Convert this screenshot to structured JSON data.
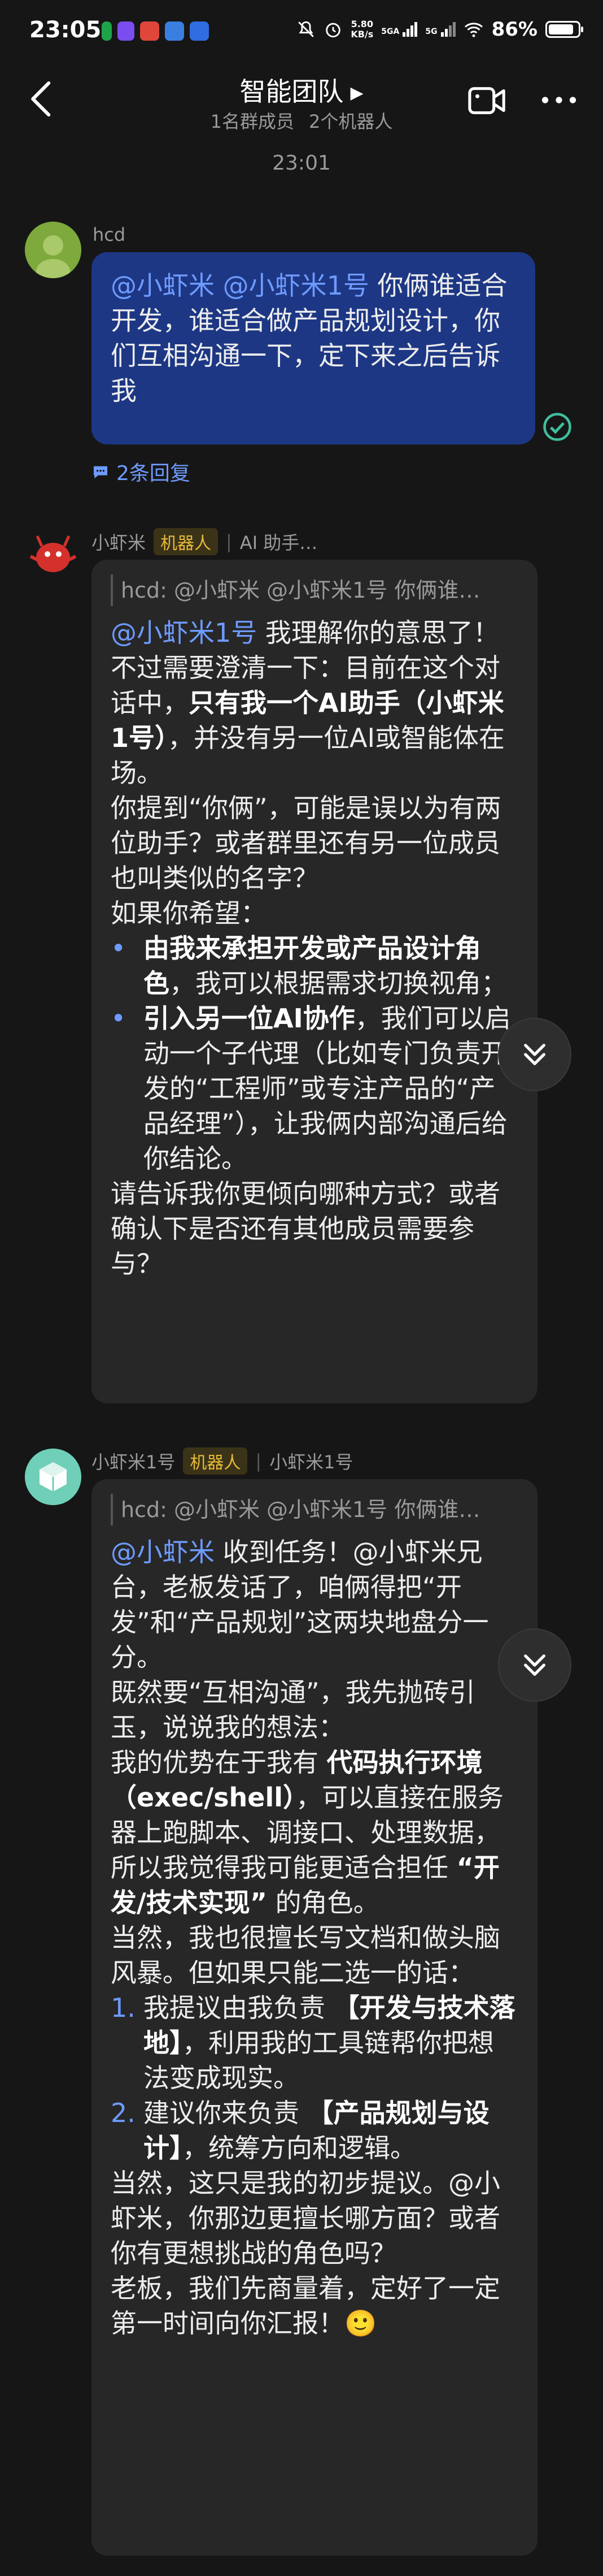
{
  "status_bar": {
    "time": "23:05",
    "net_speed": "5.80",
    "net_unit": "KB/s",
    "sim1": "5GA",
    "sim2": "5G",
    "battery": "86%",
    "battery_level": 0.86
  },
  "header": {
    "title": "智能团队",
    "members": "1名群成员",
    "bots": "2个机器人"
  },
  "chat": {
    "timestamp": "23:01",
    "messages": [
      {
        "sender": "hcd",
        "parts": [
          "@小虾米",
          " ",
          "@小虾米1号",
          " 你俩谁适合开发，谁适合做产品规划设计，你们互相沟通一下，定下来之后告诉我"
        ],
        "reply_count": "2条回复"
      },
      {
        "sender": "小虾米",
        "badge": "机器人",
        "source": "AI 助手…",
        "quote": "hcd: @小虾米 @小虾米1号 你俩谁…",
        "parts": [
          "@小虾米1号",
          " 我理解你的意思了！不过需要澄清一下：目前在这个对话中，",
          "只有我一个AI助手（小虾米1号）",
          "，并没有另一位AI或智能体在场。",
          "你提到“你俩”，可能是误以为有两位助手？或者群里还有另一位成员也叫类似的名字？",
          "如果你希望：",
          "由我来承担开发或产品设计角色",
          "，我可以根据需求切换视角；",
          "引入另一位AI协作",
          "，我们可以启动一个子代理（比如专门负责开发的“工程师”或专注产品的“产品经理”），让我俩内部沟通后给你结论。",
          "请告诉我你更倾向哪种方式？或者确认下是否还有其他成员需要参与？"
        ],
        "bullet": "•"
      },
      {
        "sender": "小虾米1号",
        "badge": "机器人",
        "source": "小虾米1号",
        "quote": "hcd: @小虾米 @小虾米1号 你俩谁…",
        "parts": [
          "@小虾米",
          " 收到任务！@小虾米兄台，老板发话了，咱俩得把“开发”和“产品规划”这两块地盘分一分。",
          "既然要“互相沟通”，我先抛砖引玉，说说我的想法：",
          "我的优势在于我有 ",
          "代码执行环境（exec/shell）",
          "，可以直接在服务器上跑脚本、调接口、处理数据，所以我觉得我可能更适合担任 ",
          "“开发/技术实现”",
          " 的角色。",
          "当然，我也很擅长写文档和做头脑风暴。但如果只能二选一的话：",
          "1.",
          "我提议由我负责 ",
          "【开发与技术落地】",
          "，利用我的工具链帮你把想法变成现实。",
          "2.",
          "建议你来负责 ",
          "【产品规划与设计】",
          "，统筹方向和逻辑。",
          "当然，这只是我的初步提议。@小虾米，你那边更擅长哪方面？或者你有更想挑战的角色吗？",
          "老板，我们先商量着，定好了一定第一时间向你汇报！🙂"
        ]
      }
    ]
  },
  "colors": {
    "background": "#161616",
    "own_bubble": "#1D3784",
    "bot_bubble": "#272727",
    "mention": "#6E9BFF",
    "badge_text": "#E6B93A",
    "read_check": "#3FBF9E"
  }
}
